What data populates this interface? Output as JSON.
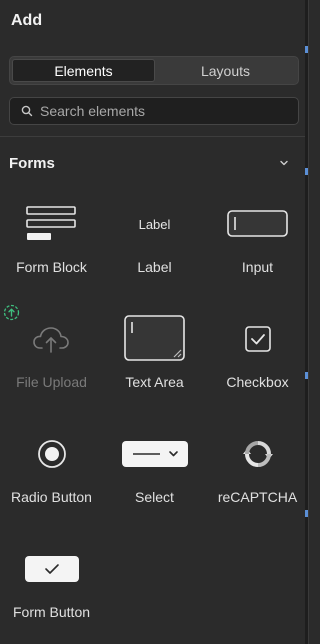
{
  "header": {
    "title": "Add"
  },
  "tabs": [
    {
      "label": "Elements",
      "active": true
    },
    {
      "label": "Layouts",
      "active": false
    }
  ],
  "search": {
    "placeholder": "Search elements",
    "value": ""
  },
  "section": {
    "title": "Forms",
    "expanded": true
  },
  "items": [
    {
      "label": "Form Block",
      "icon": "form-block-icon",
      "enabled": true
    },
    {
      "label": "Label",
      "icon": "label-icon",
      "icon_text": "Label",
      "enabled": true
    },
    {
      "label": "Input",
      "icon": "input-icon",
      "enabled": true
    },
    {
      "label": "File Upload",
      "icon": "cloud-upload-icon",
      "enabled": false,
      "badge": "upgrade-icon"
    },
    {
      "label": "Text Area",
      "icon": "text-area-icon",
      "enabled": true
    },
    {
      "label": "Checkbox",
      "icon": "checkbox-icon",
      "enabled": true
    },
    {
      "label": "Radio Button",
      "icon": "radio-button-icon",
      "enabled": true
    },
    {
      "label": "Select",
      "icon": "select-icon",
      "enabled": true
    },
    {
      "label": "reCAPTCHA",
      "icon": "recaptcha-icon",
      "enabled": true
    },
    {
      "label": "Form Button",
      "icon": "form-button-icon",
      "enabled": true
    }
  ],
  "colors": {
    "panel_bg": "#2b2b2b",
    "badge_green": "#3fbf7f",
    "edge_accent": "#5b8fd6"
  }
}
